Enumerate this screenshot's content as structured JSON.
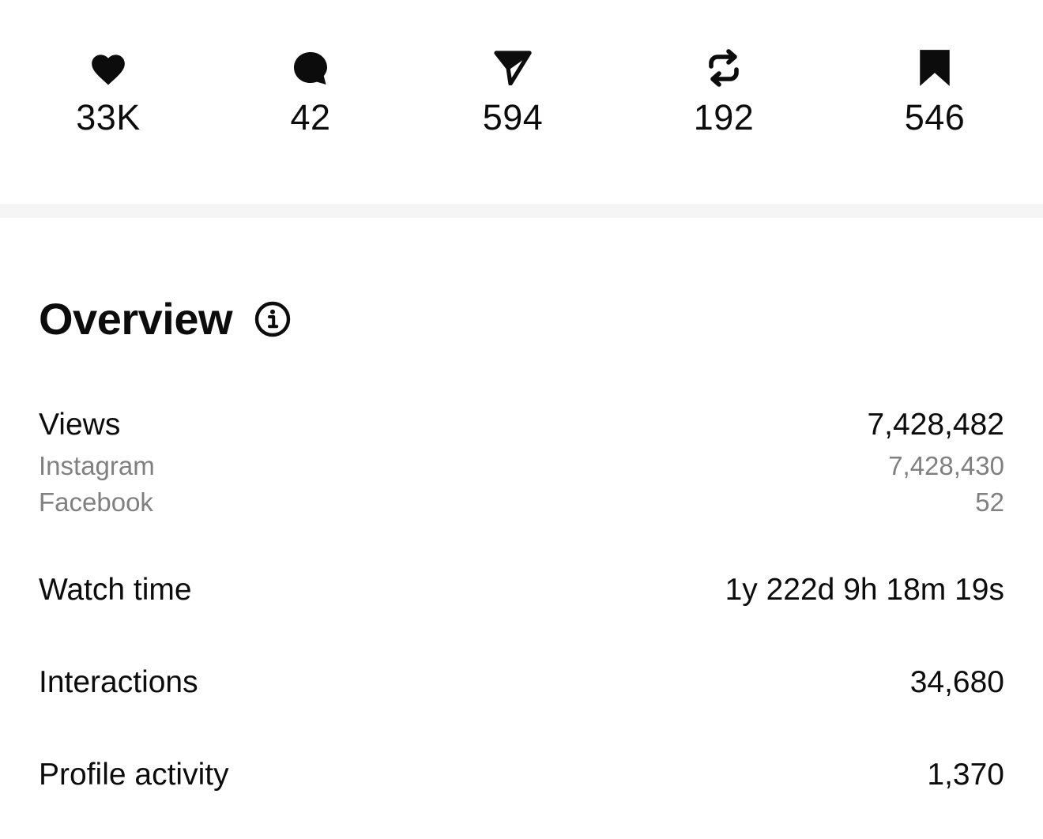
{
  "stats": {
    "likes": {
      "icon": "heart-icon",
      "count": "33K"
    },
    "comments": {
      "icon": "comment-icon",
      "count": "42"
    },
    "shares": {
      "icon": "send-icon",
      "count": "594"
    },
    "reposts": {
      "icon": "repost-icon",
      "count": "192"
    },
    "saves": {
      "icon": "bookmark-icon",
      "count": "546"
    }
  },
  "overview": {
    "title": "Overview",
    "info_icon": "info-icon",
    "rows": {
      "views": {
        "label": "Views",
        "value": "7,428,482"
      },
      "instagram": {
        "label": "Instagram",
        "value": "7,428,430"
      },
      "facebook": {
        "label": "Facebook",
        "value": "52"
      },
      "watch_time": {
        "label": "Watch time",
        "value": "1y 222d 9h 18m 19s"
      },
      "interactions": {
        "label": "Interactions",
        "value": "34,680"
      },
      "profile": {
        "label": "Profile activity",
        "value": "1,370"
      }
    }
  },
  "colors": {
    "text": "#0c0c0c",
    "secondary_text": "#808080",
    "divider": "#f5f5f5",
    "background": "#ffffff"
  }
}
